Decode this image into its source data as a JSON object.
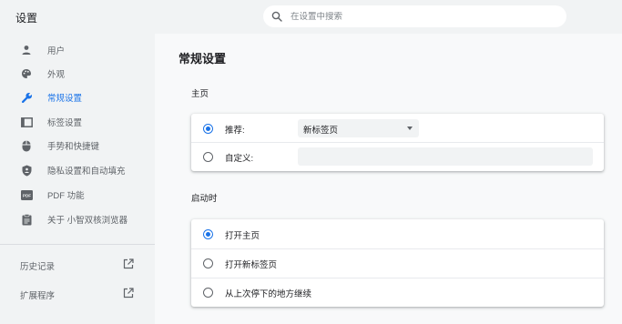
{
  "app": {
    "title": "设置"
  },
  "search": {
    "placeholder": "在设置中搜索"
  },
  "sidebar": {
    "items": [
      {
        "label": "用户",
        "icon": "person-icon"
      },
      {
        "label": "外观",
        "icon": "palette-icon"
      },
      {
        "label": "常规设置",
        "icon": "wrench-icon",
        "active": true
      },
      {
        "label": "标签设置",
        "icon": "tab-icon"
      },
      {
        "label": "手势和快捷键",
        "icon": "mouse-icon"
      },
      {
        "label": "隐私设置和自动填充",
        "icon": "shield-icon"
      },
      {
        "label": "PDF 功能",
        "icon": "pdf-icon"
      },
      {
        "label": "关于 小智双核浏览器",
        "icon": "clipboard-icon"
      }
    ],
    "links": [
      {
        "label": "历史记录"
      },
      {
        "label": "扩展程序"
      }
    ]
  },
  "main": {
    "title": "常规设置",
    "homepage": {
      "section_title": "主页",
      "recommend_label": "推荐:",
      "recommend_value": "新标签页",
      "custom_label": "自定义:",
      "custom_value": ""
    },
    "startup": {
      "section_title": "启动时",
      "options": [
        {
          "label": "打开主页",
          "checked": true
        },
        {
          "label": "打开新标签页",
          "checked": false
        },
        {
          "label": "从上次停下的地方继续",
          "checked": false
        }
      ]
    }
  },
  "colors": {
    "accent": "#1a73e8",
    "sidebar_bg": "#f1f3f4",
    "main_bg": "#f8f9fa"
  }
}
